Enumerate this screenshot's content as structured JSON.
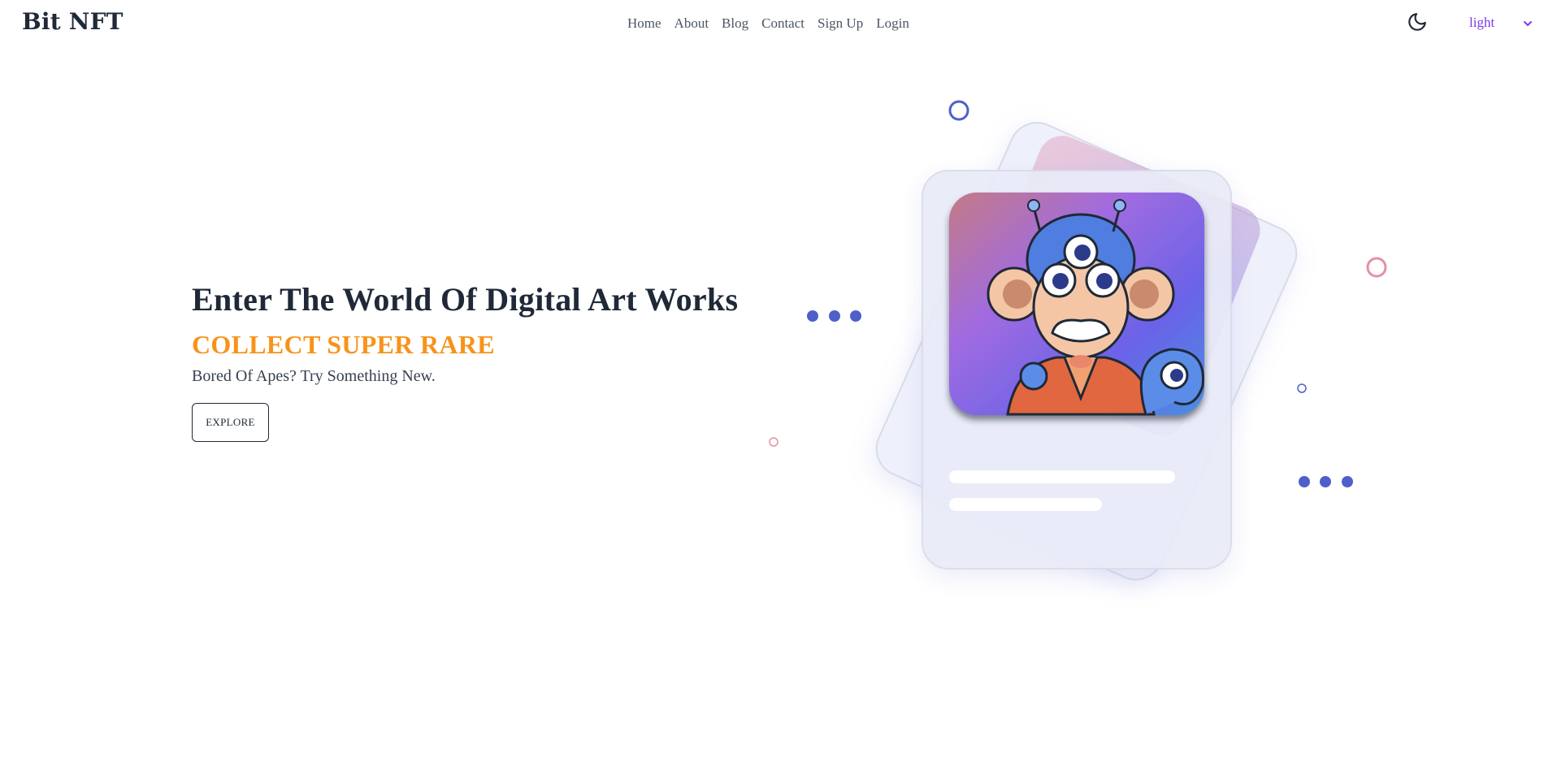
{
  "brand": {
    "name": "Bit NFT"
  },
  "nav": {
    "links": [
      "Home",
      "About",
      "Blog",
      "Contact",
      "Sign Up",
      "Login"
    ]
  },
  "theme": {
    "selected": "light",
    "icon": "moon-icon"
  },
  "hero": {
    "title": "Enter The World Of Digital Art Works",
    "subtitle": "COLLECT SUPER RARE",
    "tagline": "Bored Of Apes? Try Something New.",
    "cta": "EXPLORE"
  },
  "colors": {
    "accent_orange": "#f7931a",
    "accent_purple": "#7c3aed",
    "dot_blue": "#4f5fc9",
    "ring_pink": "#e88fa3"
  }
}
